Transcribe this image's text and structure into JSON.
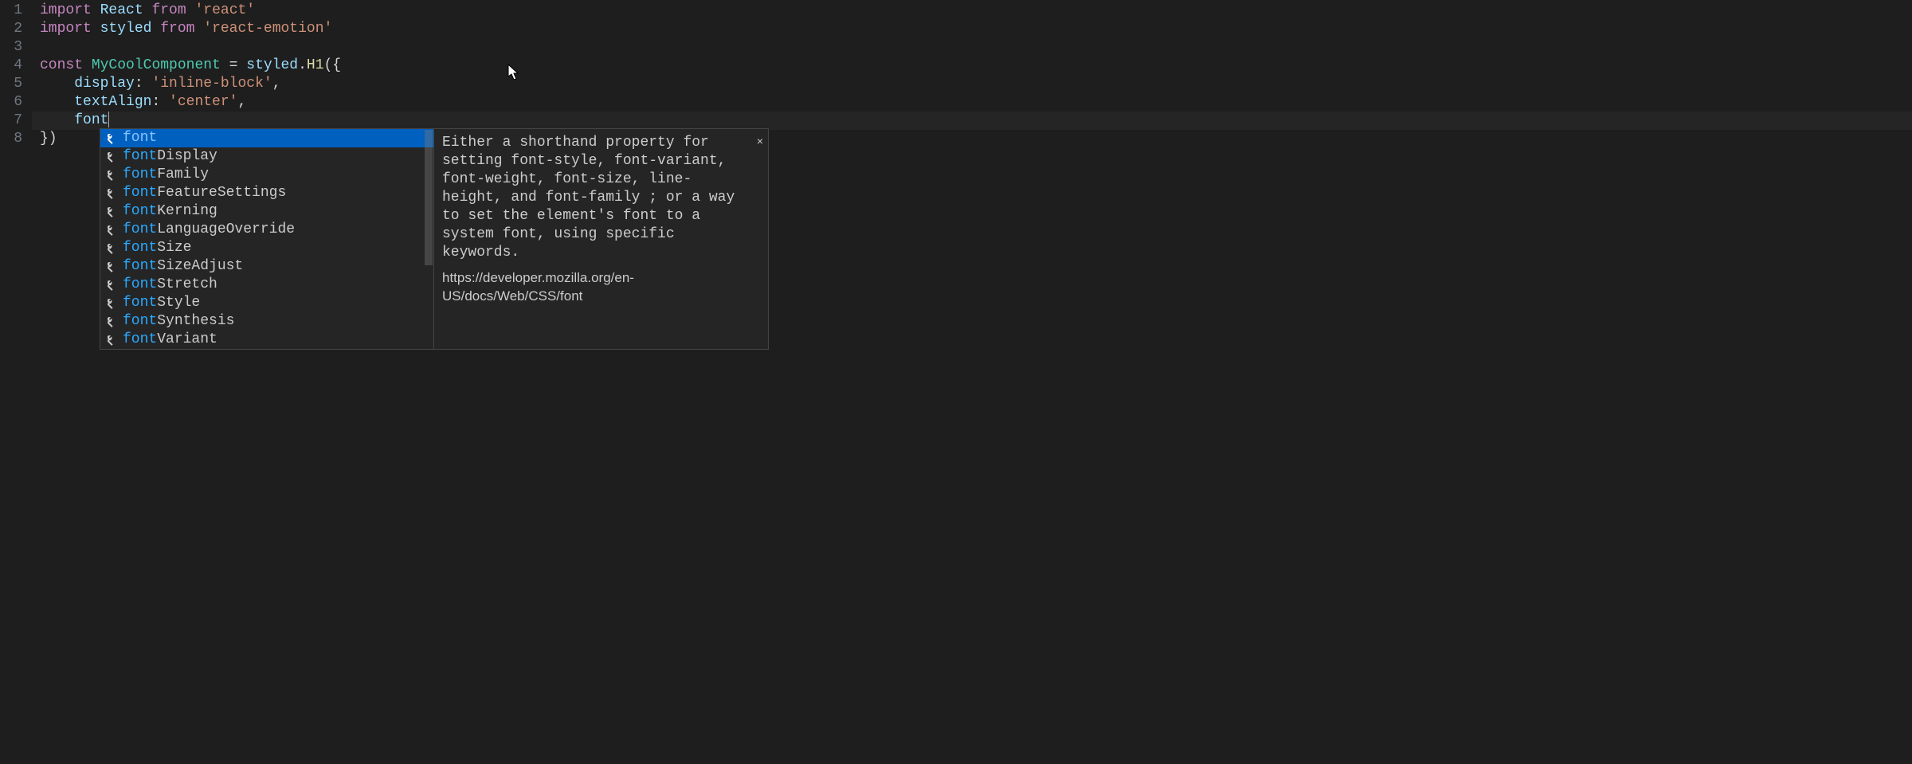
{
  "gutter": {
    "lines": [
      "1",
      "2",
      "3",
      "4",
      "5",
      "6",
      "7",
      "8"
    ]
  },
  "code": {
    "l1": {
      "kw1": "import",
      "name": "React",
      "kw2": "from",
      "str": "'react'"
    },
    "l2": {
      "kw1": "import",
      "name": "styled",
      "kw2": "from",
      "str": "'react-emotion'"
    },
    "l3": "",
    "l4": {
      "kw": "const",
      "name": "MyCoolComponent",
      "op": " = ",
      "obj": "styled",
      "dot": ".",
      "fn": "H1",
      "open": "({"
    },
    "l5": {
      "indent": "    ",
      "prop": "display",
      "colon": ": ",
      "val": "'inline-block'",
      "comma": ","
    },
    "l6": {
      "indent": "    ",
      "prop": "textAlign",
      "colon": ": ",
      "val": "'center'",
      "comma": ","
    },
    "l7": {
      "indent": "    ",
      "typed": "font"
    },
    "l8": {
      "close": "})"
    }
  },
  "autocomplete": {
    "items": [
      {
        "match": "font",
        "rest": ""
      },
      {
        "match": "font",
        "rest": "Display"
      },
      {
        "match": "font",
        "rest": "Family"
      },
      {
        "match": "font",
        "rest": "FeatureSettings"
      },
      {
        "match": "font",
        "rest": "Kerning"
      },
      {
        "match": "font",
        "rest": "LanguageOverride"
      },
      {
        "match": "font",
        "rest": "Size"
      },
      {
        "match": "font",
        "rest": "SizeAdjust"
      },
      {
        "match": "font",
        "rest": "Stretch"
      },
      {
        "match": "font",
        "rest": "Style"
      },
      {
        "match": "font",
        "rest": "Synthesis"
      },
      {
        "match": "font",
        "rest": "Variant"
      }
    ],
    "selected_index": 0,
    "doc": {
      "text": "Either a shorthand property for setting font-style, font-variant, font-weight, font-size, line-height, and font-family ; or a way to set the element's font to a system font, using specific keywords.",
      "link": "https://developer.mozilla.org/en-US/docs/Web/CSS/font",
      "close": "×"
    }
  }
}
